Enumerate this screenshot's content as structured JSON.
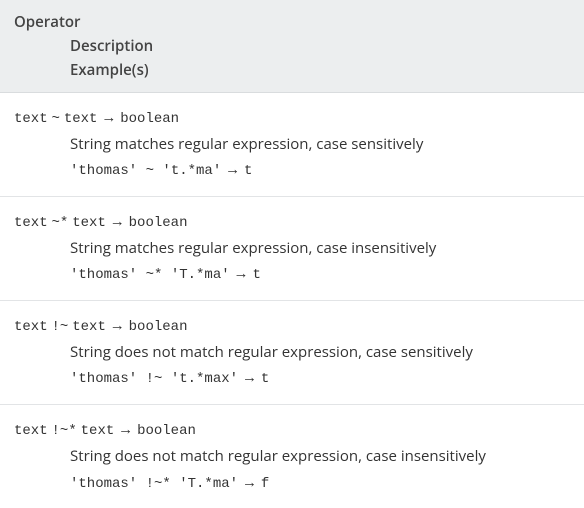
{
  "header": {
    "operator_label": "Operator",
    "description_label": "Description",
    "examples_label": "Example(s)"
  },
  "rows": [
    {
      "sig_left": "text",
      "sig_op": "~",
      "sig_right": "text",
      "sig_arrow": "→",
      "sig_return": "boolean",
      "description": "String matches regular expression, case sensitively",
      "example_expr": "'thomas' ~ 't.*ma'",
      "example_arrow": "→",
      "example_result": "t"
    },
    {
      "sig_left": "text",
      "sig_op": "~*",
      "sig_right": "text",
      "sig_arrow": "→",
      "sig_return": "boolean",
      "description": "String matches regular expression, case insensitively",
      "example_expr": "'thomas' ~* 'T.*ma'",
      "example_arrow": "→",
      "example_result": "t"
    },
    {
      "sig_left": "text",
      "sig_op": "!~",
      "sig_right": "text",
      "sig_arrow": "→",
      "sig_return": "boolean",
      "description": "String does not match regular expression, case sensitively",
      "example_expr": "'thomas' !~ 't.*max'",
      "example_arrow": "→",
      "example_result": "t"
    },
    {
      "sig_left": "text",
      "sig_op": "!~*",
      "sig_right": "text",
      "sig_arrow": "→",
      "sig_return": "boolean",
      "description": "String does not match regular expression, case insensitively",
      "example_expr": "'thomas' !~* 'T.*ma'",
      "example_arrow": "→",
      "example_result": "f"
    }
  ]
}
